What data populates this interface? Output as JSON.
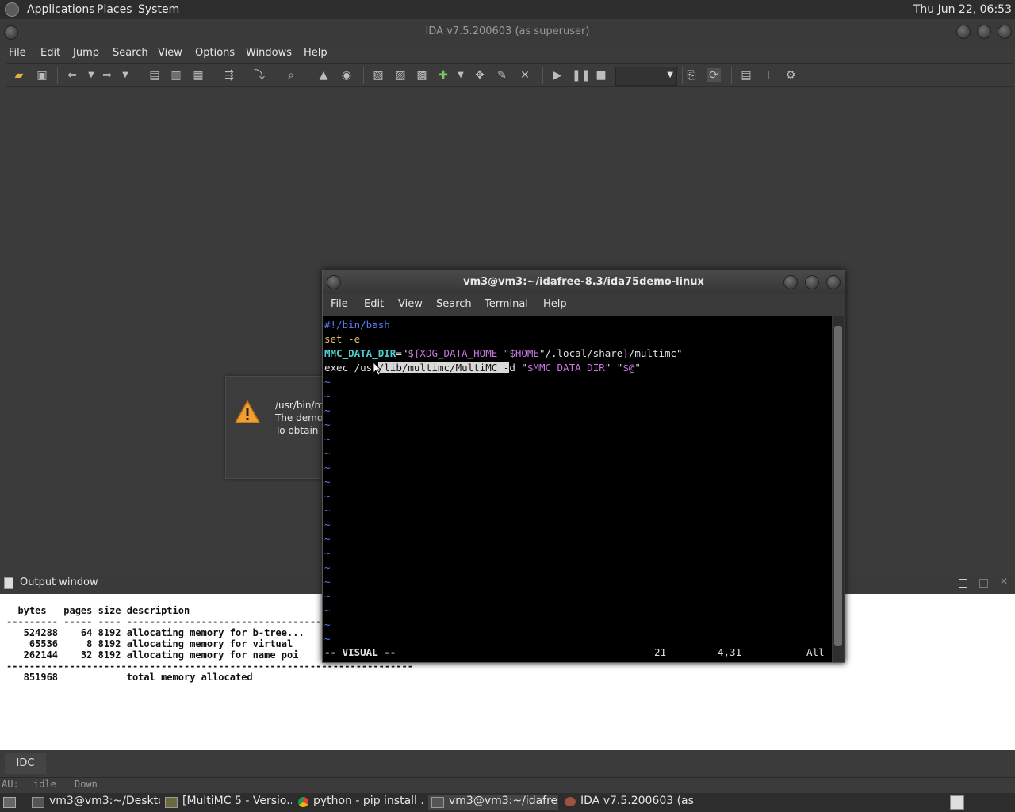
{
  "top_panel": {
    "menus": [
      "Applications",
      "Places",
      "System"
    ],
    "clock": "Thu Jun 22, 06:53"
  },
  "ida": {
    "title": "IDA v7.5.200603 (as superuser)",
    "menus": [
      "File",
      "Edit",
      "Jump",
      "Search",
      "View",
      "Options",
      "Windows",
      "Help"
    ]
  },
  "dialog": {
    "line1": "/usr/bin/m",
    "line2": "The demo",
    "line3": "To obtain"
  },
  "output": {
    "title": "Output window",
    "header": "  bytes   pages size description",
    "rule1": "--------- ----- ---- --------------------------------------------",
    "rows": [
      "   524288    64 8192 allocating memory for b-tree...",
      "    65536     8 8192 allocating memory for virtual",
      "   262144    32 8192 allocating memory for name poi"
    ],
    "rule2": "-----------------------------------------------------------------------",
    "total": "   851968            total memory allocated"
  },
  "idc_tab": "IDC",
  "status": {
    "au": "AU:",
    "state": "idle",
    "dir": "Down"
  },
  "terminal": {
    "title": "vm3@vm3:~/idafree-8.3/ida75demo-linux",
    "menus": [
      "File",
      "Edit",
      "View",
      "Search",
      "Terminal",
      "Help"
    ],
    "line1": "#!/bin/bash",
    "line2": "set -e",
    "line3_var": "MMC_DATA_DIR",
    "line3_eq": "=\"",
    "line3_exp": "${XDG_DATA_HOME-\"",
    "line3_home": "$HOME",
    "line3_rest": "\"/.local/share",
    "line3_close": "}",
    "line3_tail": "/multimc\"",
    "line4_exec": "exec /us",
    "line4_r": "r",
    "line4_sel": "/lib/multimc/MultiMC -",
    "line4_after": "d \"",
    "line4_var": "$MMC_DATA_DIR",
    "line4_mid": "\" \"",
    "line4_at": "$@",
    "line4_end": "\"",
    "tilde": "~",
    "mode": "-- VISUAL --",
    "count": "21",
    "pos": "4,31",
    "scroll": "All"
  },
  "taskbar": {
    "tasks": [
      "vm3@vm3:~/Desktop",
      "[MultiMC 5 - Versio...",
      "python - pip install ...",
      "vm3@vm3:~/idafre...",
      "IDA v7.5.200603 (as ..."
    ]
  }
}
